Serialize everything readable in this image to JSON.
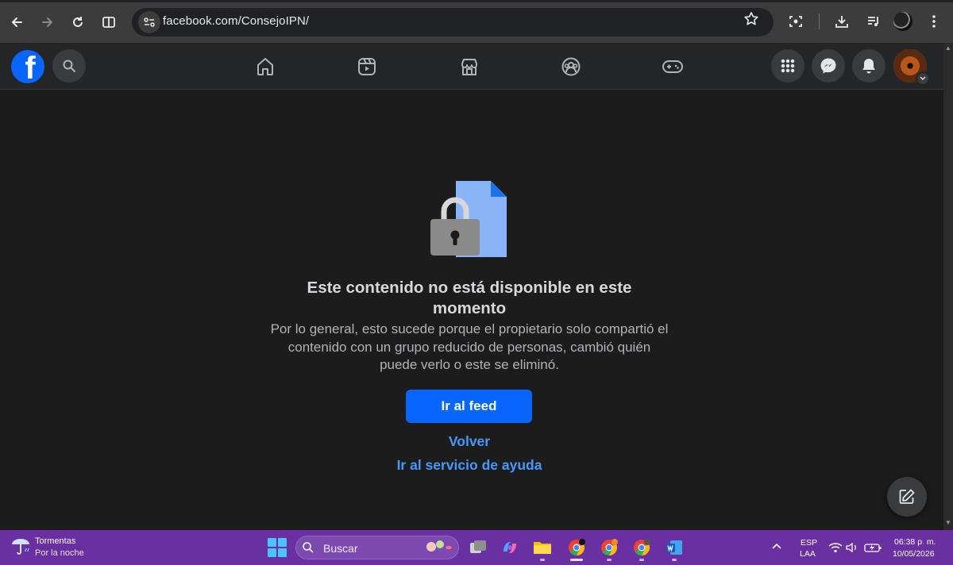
{
  "browser": {
    "url": "facebook.com/ConsejoIPN/",
    "icons": [
      "back-arrow-icon",
      "forward-arrow-icon",
      "reload-icon",
      "split-view-icon",
      "site-info-icon",
      "bookmark-star-icon",
      "google-lens-icon",
      "download-icon",
      "media-controls-icon",
      "profile-avatar",
      "menu-dots-icon"
    ]
  },
  "facebook": {
    "logo_letter": "f",
    "nav_icons": [
      "home-icon",
      "reels-icon",
      "marketplace-icon",
      "groups-icon",
      "gaming-icon"
    ],
    "right_icons": [
      "apps-grid-icon",
      "messenger-icon",
      "notifications-bell-icon",
      "account-avatar"
    ],
    "accent": "#0866ff"
  },
  "content": {
    "heading": "Este contenido no está disponible en este momento",
    "description": "Por lo general, esto sucede porque el propietario solo compartió el contenido con un grupo reducido de personas, cambió quién puede verlo o este se eliminó.",
    "primary_button": "Ir al feed",
    "back_link": "Volver",
    "help_link": "Ir al servicio de ayuda"
  },
  "taskbar": {
    "weather_title": "Tormentas",
    "weather_sub": "Por la noche",
    "search_placeholder": "Buscar",
    "lang_line1": "ESP",
    "lang_line2": "LAA",
    "time": "06:38 p. m.",
    "date": "10/05/2026",
    "background": "#6a2fa0"
  }
}
